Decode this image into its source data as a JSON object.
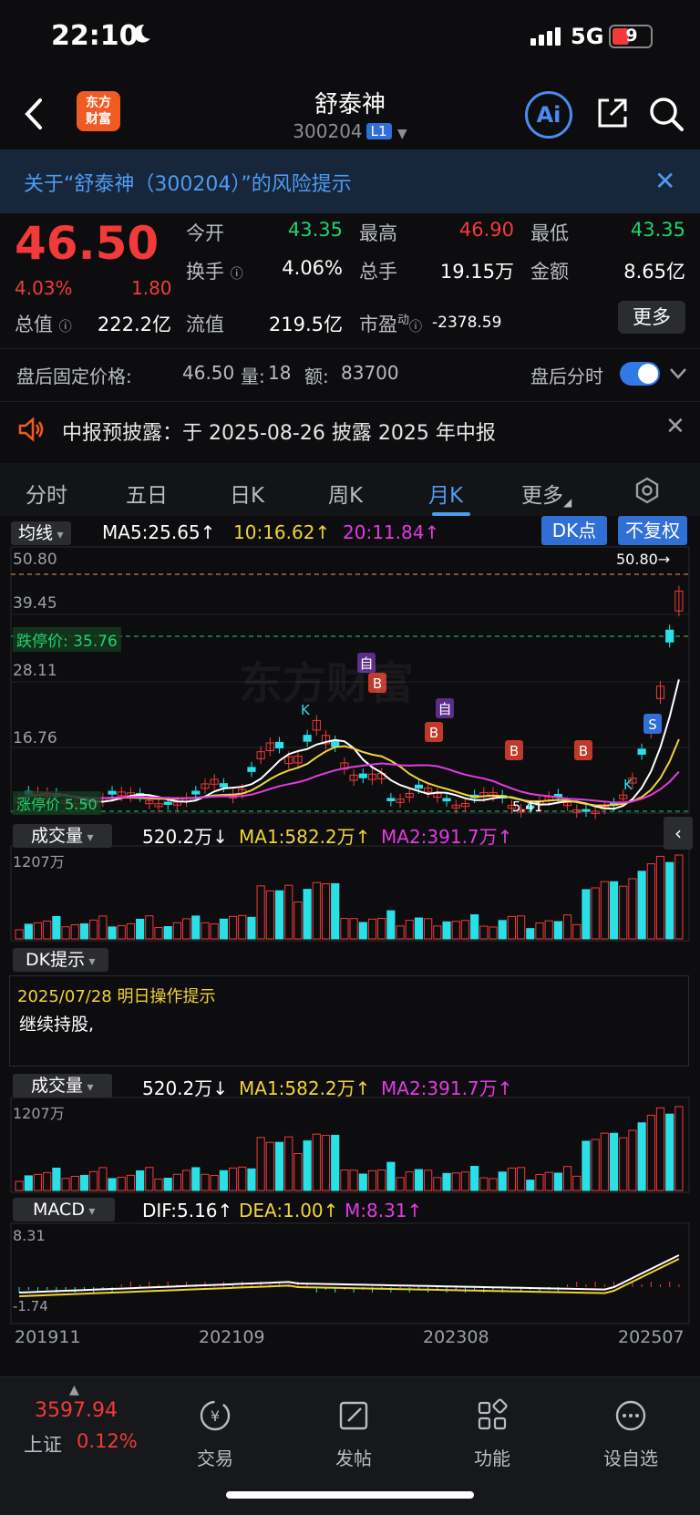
{
  "status": {
    "time": "22:10",
    "network": "5G",
    "battery": "9"
  },
  "header": {
    "title": "舒泰神",
    "code": "300204",
    "level": "L1",
    "logo_line1": "东方",
    "logo_line2": "财富",
    "ai_label": "Ai"
  },
  "notice": {
    "text": "关于“舒泰神（300204）”的风险提示",
    "close": "✕"
  },
  "quote": {
    "price": "46.50",
    "pct": "4.03%",
    "change": "1.80",
    "items": [
      {
        "label": "今开",
        "value": "43.35",
        "color": "#1fd36c"
      },
      {
        "label": "最高",
        "value": "46.90",
        "color": "#f23a3a"
      },
      {
        "label": "最低",
        "value": "43.35",
        "color": "#1fd36c"
      },
      {
        "label": "换手",
        "value": "4.06%",
        "color": "#ffffff"
      },
      {
        "label": "总手",
        "value": "19.15万",
        "color": "#ffffff"
      },
      {
        "label": "金额",
        "value": "8.65亿",
        "color": "#ffffff"
      },
      {
        "label": "流值",
        "value": "219.5亿",
        "color": "#ffffff"
      },
      {
        "label": "市盈",
        "value": "-2378.59",
        "color": "#ffffff"
      }
    ],
    "total_label": "总值",
    "total_value": "222.2亿",
    "more": "更多",
    "pe_sup": "动"
  },
  "after_hours": {
    "label": "盘后固定价格:",
    "price": "46.50",
    "vol_label": "量:",
    "vol": "18",
    "amt_label": "额:",
    "amt": "83700",
    "toggle_label": "盘后分时"
  },
  "report": {
    "text": "中报预披露：于 2025-08-26 披露 2025 年中报",
    "close": "✕"
  },
  "tabs": [
    {
      "label": "分时",
      "active": false
    },
    {
      "label": "五日",
      "active": false
    },
    {
      "label": "日K",
      "active": false
    },
    {
      "label": "周K",
      "active": false
    },
    {
      "label": "月K",
      "active": true
    },
    {
      "label": "更多",
      "active": false
    }
  ],
  "ma": {
    "dropdown": "均线",
    "ma5": "MA5:25.65↑",
    "ma10": "10:16.62↑",
    "ma20": "20:11.84↑",
    "dk_btn": "DK点",
    "fq_btn": "不复权"
  },
  "kline": {
    "y_labels": [
      "50.80",
      "39.45",
      "28.11",
      "16.76"
    ],
    "max_label": "50.80→",
    "limit_down": "跌停价: 35.76",
    "limit_up": "涨停价 5.50",
    "low_label": "5.41",
    "colors": {
      "up": "#f23a3a",
      "down": "#28e0e6",
      "ma5": "#ffffff",
      "ma10": "#f0d23a",
      "ma20": "#e23be3"
    },
    "watermark": "东方财富",
    "markers": [
      "B",
      "B",
      "B",
      "B",
      "S",
      "自",
      "自",
      "K",
      "K"
    ]
  },
  "volume1": {
    "dropdown": "成交量",
    "value": "520.2万↓",
    "ma1": "MA1:582.2万↑",
    "ma2": "MA2:391.7万↑",
    "max_label": "1207万"
  },
  "dk": {
    "dropdown": "DK提示",
    "date_line": "2025/07/28 明日操作提示",
    "advice": "继续持股,"
  },
  "volume2": {
    "dropdown": "成交量",
    "value": "520.2万↓",
    "ma1": "MA1:582.2万↑",
    "ma2": "MA2:391.7万↑",
    "max_label": "1207万"
  },
  "macd": {
    "dropdown": "MACD",
    "dif": "DIF:5.16↑",
    "dea": "DEA:1.00↑",
    "m": "M:8.31↑",
    "top_label": "8.31",
    "bottom_label": "-1.74"
  },
  "x_axis": [
    "201911",
    "202109",
    "202308",
    "202507"
  ],
  "bottom_nav": {
    "index_value": "3597.94",
    "index_name": "上证",
    "index_pct": "0.12%",
    "items": [
      {
        "label": "交易"
      },
      {
        "label": "发帖"
      },
      {
        "label": "功能"
      },
      {
        "label": "设自选"
      }
    ]
  }
}
